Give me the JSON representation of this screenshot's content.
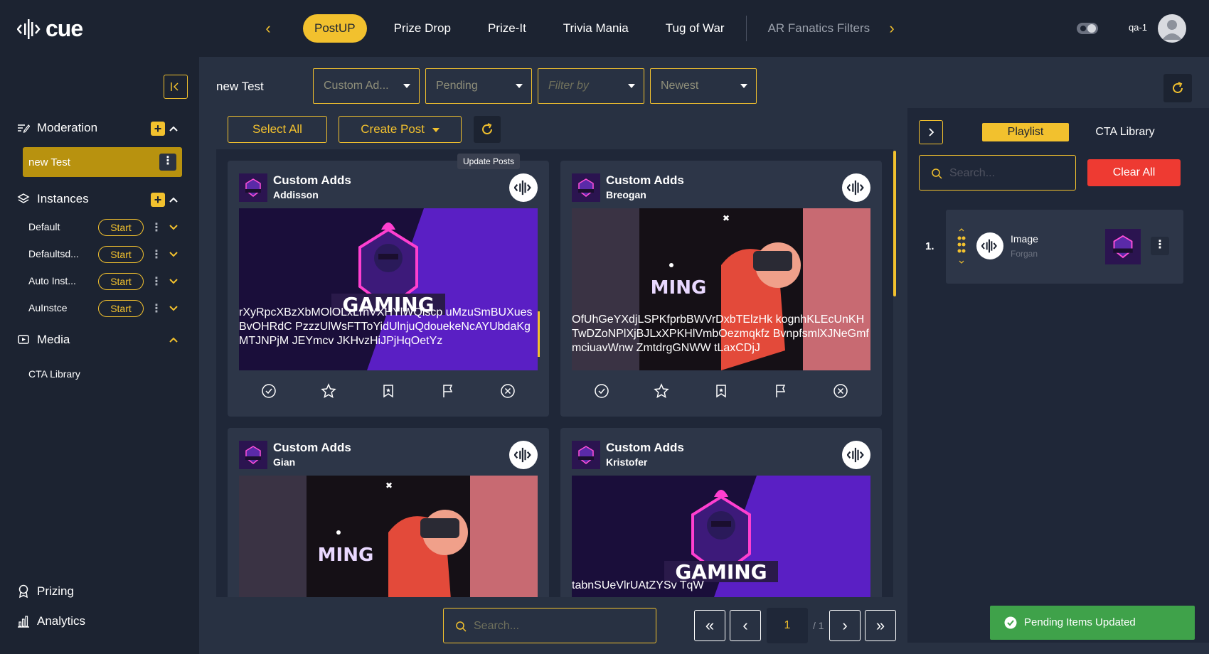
{
  "app": {
    "logo_text": "cue",
    "user_label": "qa-1"
  },
  "colors": {
    "accent": "#f2c12e",
    "danger": "#ee3a32",
    "success": "#3fa24a",
    "background": "#1c2331"
  },
  "tabs": [
    {
      "label": "PostUP",
      "active": true
    },
    {
      "label": "Prize Drop"
    },
    {
      "label": "Prize-It"
    },
    {
      "label": "Trivia Mania"
    },
    {
      "label": "Tug of War"
    },
    {
      "label": "AR Fanatics Filters",
      "faded": true
    }
  ],
  "sidebar": {
    "moderation_label": "Moderation",
    "moderation_item": "new Test",
    "instances_label": "Instances",
    "instances": [
      {
        "name": "Default",
        "action": "Start"
      },
      {
        "name": "Defaultsd...",
        "action": "Start"
      },
      {
        "name": "Auto Inst...",
        "action": "Start"
      },
      {
        "name": "AuInstce",
        "action": "Start"
      }
    ],
    "media_label": "Media",
    "media_items": [
      "CTA Library"
    ],
    "prizing_label": "Prizing",
    "analytics_label": "Analytics"
  },
  "main": {
    "feed_title": "new Test",
    "filters": {
      "source": "Custom Ad...",
      "status": "Pending",
      "filter_by": "Filter by",
      "sort": "Newest"
    },
    "select_all": "Select All",
    "create_post": "Create Post",
    "tooltip": "Update Posts",
    "search_placeholder": "Search...",
    "pagination": {
      "current": "1",
      "total": "/ 1"
    }
  },
  "cards": [
    {
      "title": "Custom Adds",
      "author": "Addisson",
      "image": "gaming-logo",
      "text": "rXyRpcXBzXbMOlOLxLrnVXHYlWQlscp uMzuSmBUXuesBvOHRdC PzzzUlWsFTToYidUlnjuQdouekeNcAYUbdaKgMTJNPjM JEYmcv JKHvzHiJPjHqOetYz"
    },
    {
      "title": "Custom Adds",
      "author": "Breogan",
      "image": "gaming-vr",
      "text": "OfUhGeYXdjLSPKfprbBWVrDxbTElzHk kognhKLEcUnKHTwDZoNPlXjBJLxXPKHlVmbOezmqkfz BvnpfsmlXJNeGmfmciuavWnw ZmtdrgGNWW tLaxCDjJ"
    },
    {
      "title": "Custom Adds",
      "author": "Gian",
      "image": "gaming-vr",
      "text": ""
    },
    {
      "title": "Custom Adds",
      "author": "Kristofer",
      "image": "gaming-logo",
      "text": "tabnSUeVlrUAtZYSv TqW"
    }
  ],
  "playlist": {
    "tab_playlist": "Playlist",
    "tab_cta": "CTA Library",
    "search_placeholder": "Search...",
    "clear_all": "Clear All",
    "items": [
      {
        "index": "1.",
        "title": "Image",
        "subtitle": "Forgan"
      }
    ]
  },
  "toast": {
    "message": "Pending Items Updated"
  },
  "icons": {
    "refresh": "refresh-icon",
    "approve": "check-circle-icon",
    "star": "star-icon",
    "bookmark": "bookmark-icon",
    "flag": "flag-icon",
    "reject": "close-circle-icon"
  }
}
